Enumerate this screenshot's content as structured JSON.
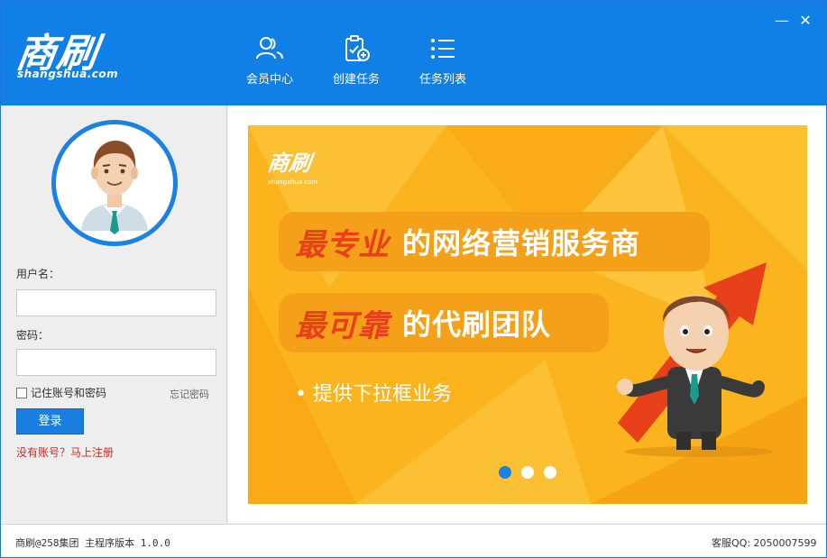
{
  "app": {
    "logo_main": "商刷",
    "logo_sub": "shangshua.com"
  },
  "window_controls": {
    "minimize": "—",
    "close": "✕"
  },
  "nav": [
    {
      "label": "会员中心",
      "icon": "users-icon"
    },
    {
      "label": "创建任务",
      "icon": "clipboard-add-icon"
    },
    {
      "label": "任务列表",
      "icon": "list-icon"
    }
  ],
  "login": {
    "username_label": "用户名：",
    "username_value": "",
    "password_label": "密码：",
    "password_value": "",
    "remember_label": "记住账号和密码",
    "forgot_label": "忘记密码",
    "login_button": "登录",
    "register_link": "没有账号？马上注册"
  },
  "banner": {
    "logo_main": "商刷",
    "logo_sub": "shangshua.com",
    "slogan1_highlight": "最专业",
    "slogan1_rest": "的网络营销服务商",
    "slogan2_highlight": "最可靠",
    "slogan2_rest": "的代刷团队",
    "bullet": "• 提供下拉框业务",
    "active_slide": 1,
    "slide_count": 3,
    "colors": {
      "background": "#fbb41d",
      "highlight": "#e8401b",
      "dot_active": "#1a82e2"
    }
  },
  "footer": {
    "left": "商刷@258集团 主程序版本 1.0.0",
    "right": "客服QQ: 2050007599"
  },
  "colors": {
    "header": "#1080e6",
    "accent": "#1a7fe0",
    "link_red": "#d12a2a"
  }
}
